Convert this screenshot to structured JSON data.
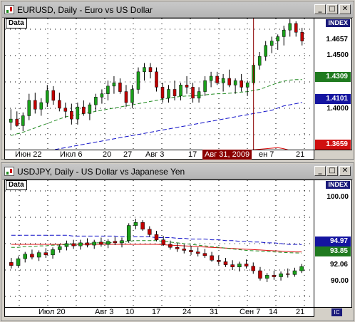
{
  "colors": {
    "bull": "#1aa01a",
    "bear": "#c00000",
    "ma_green": "#228b22",
    "ma_blue": "#1010c8",
    "ma_red": "#e01010",
    "grid": "#000000"
  },
  "windows": [
    {
      "title": "EURUSD, Daily - Euro vs US Dollar",
      "data_label": "Data",
      "index_label": "INDEX",
      "y_ticks": [
        "1.4500",
        "1.4000"
      ],
      "price_badges": [
        {
          "value": "1.4657",
          "bg": "#ffffff",
          "fg": "#000000"
        },
        {
          "value": "1.4309",
          "bg": "#1f7a1f",
          "fg": "#ffffff"
        },
        {
          "value": "1.4101",
          "bg": "#1414a0",
          "fg": "#ffffff"
        },
        {
          "value": "1.3659",
          "bg": "#d01010",
          "fg": "#ffffff"
        }
      ],
      "x_ticks": [
        "Июн 22",
        "Июл 6",
        "20",
        "27",
        "Авг 3",
        "17",
        "ен 7",
        "21"
      ],
      "x_cursor": "Авг 31, 2009",
      "chart_data": {
        "type": "candlestick",
        "ylim": [
          1.3659,
          1.4865
        ],
        "ohlc": [
          [
            1.392,
            1.404,
            1.385,
            1.395
          ],
          [
            1.395,
            1.402,
            1.388,
            1.389
          ],
          [
            1.389,
            1.401,
            1.384,
            1.398
          ],
          [
            1.398,
            1.418,
            1.394,
            1.412
          ],
          [
            1.412,
            1.419,
            1.4,
            1.404
          ],
          [
            1.404,
            1.414,
            1.398,
            1.41
          ],
          [
            1.41,
            1.426,
            1.406,
            1.421
          ],
          [
            1.421,
            1.425,
            1.408,
            1.412
          ],
          [
            1.412,
            1.419,
            1.402,
            1.405
          ],
          [
            1.405,
            1.41,
            1.396,
            1.402
          ],
          [
            1.402,
            1.409,
            1.39,
            1.395
          ],
          [
            1.395,
            1.41,
            1.39,
            1.406
          ],
          [
            1.406,
            1.412,
            1.398,
            1.4
          ],
          [
            1.4,
            1.41,
            1.394,
            1.408
          ],
          [
            1.408,
            1.418,
            1.402,
            1.415
          ],
          [
            1.415,
            1.422,
            1.409,
            1.418
          ],
          [
            1.418,
            1.43,
            1.412,
            1.425
          ],
          [
            1.425,
            1.434,
            1.418,
            1.428
          ],
          [
            1.428,
            1.432,
            1.418,
            1.42
          ],
          [
            1.42,
            1.426,
            1.406,
            1.41
          ],
          [
            1.41,
            1.426,
            1.405,
            1.422
          ],
          [
            1.422,
            1.442,
            1.418,
            1.438
          ],
          [
            1.438,
            1.446,
            1.43,
            1.442
          ],
          [
            1.442,
            1.446,
            1.432,
            1.438
          ],
          [
            1.438,
            1.442,
            1.42,
            1.424
          ],
          [
            1.424,
            1.428,
            1.41,
            1.414
          ],
          [
            1.414,
            1.426,
            1.41,
            1.422
          ],
          [
            1.422,
            1.43,
            1.412,
            1.416
          ],
          [
            1.416,
            1.428,
            1.412,
            1.426
          ],
          [
            1.426,
            1.434,
            1.418,
            1.424
          ],
          [
            1.424,
            1.428,
            1.41,
            1.414
          ],
          [
            1.414,
            1.424,
            1.41,
            1.42
          ],
          [
            1.42,
            1.434,
            1.416,
            1.43
          ],
          [
            1.43,
            1.438,
            1.424,
            1.434
          ],
          [
            1.434,
            1.438,
            1.426,
            1.428
          ],
          [
            1.428,
            1.436,
            1.42,
            1.432
          ],
          [
            1.432,
            1.44,
            1.424,
            1.426
          ],
          [
            1.426,
            1.432,
            1.418,
            1.43
          ],
          [
            1.43,
            1.436,
            1.42,
            1.424
          ],
          [
            1.424,
            1.43,
            1.416,
            1.428
          ],
          [
            1.428,
            1.446,
            1.426,
            1.444
          ],
          [
            1.444,
            1.456,
            1.44,
            1.452
          ],
          [
            1.452,
            1.466,
            1.448,
            1.462
          ],
          [
            1.462,
            1.47,
            1.455,
            1.466
          ],
          [
            1.466,
            1.472,
            1.458,
            1.47
          ],
          [
            1.47,
            1.48,
            1.462,
            1.476
          ],
          [
            1.476,
            1.486,
            1.47,
            1.482
          ],
          [
            1.482,
            1.484,
            1.47,
            1.474
          ],
          [
            1.474,
            1.478,
            1.462,
            1.466
          ]
        ],
        "moving_averages": [
          {
            "color": "green",
            "values": [
              1.38,
              1.3815,
              1.383,
              1.385,
              1.387,
              1.389,
              1.391,
              1.393,
              1.395,
              1.397,
              1.398,
              1.399,
              1.4,
              1.401,
              1.402,
              1.403,
              1.404,
              1.405,
              1.406,
              1.407,
              1.408,
              1.409,
              1.41,
              1.411,
              1.412,
              1.413,
              1.414,
              1.415,
              1.4155,
              1.416,
              1.416,
              1.4165,
              1.417,
              1.4175,
              1.418,
              1.418,
              1.4185,
              1.419,
              1.4195,
              1.42,
              1.421,
              1.422,
              1.424,
              1.426,
              1.428,
              1.4295,
              1.4305,
              1.4309,
              1.4309
            ]
          },
          {
            "color": "blue",
            "values": [
              1.36,
              1.361,
              1.362,
              1.363,
              1.364,
              1.365,
              1.366,
              1.367,
              1.368,
              1.369,
              1.37,
              1.371,
              1.372,
              1.373,
              1.374,
              1.375,
              1.376,
              1.377,
              1.378,
              1.379,
              1.38,
              1.381,
              1.382,
              1.383,
              1.384,
              1.385,
              1.386,
              1.387,
              1.388,
              1.389,
              1.39,
              1.391,
              1.392,
              1.393,
              1.394,
              1.395,
              1.396,
              1.397,
              1.398,
              1.399,
              1.4,
              1.401,
              1.402,
              1.403,
              1.405,
              1.407,
              1.408,
              1.409,
              1.4101
            ]
          },
          {
            "color": "red",
            "values": [
              1.33,
              1.331,
              1.332,
              1.333,
              1.334,
              1.335,
              1.336,
              1.337,
              1.338,
              1.339,
              1.34,
              1.341,
              1.342,
              1.343,
              1.344,
              1.345,
              1.346,
              1.347,
              1.348,
              1.349,
              1.35,
              1.351,
              1.352,
              1.353,
              1.354,
              1.355,
              1.356,
              1.357,
              1.358,
              1.359,
              1.36,
              1.361,
              1.362,
              1.363,
              1.364,
              1.3645,
              1.365,
              1.3655,
              1.366,
              1.3665,
              1.367,
              1.3675,
              1.368,
              1.3685,
              1.369,
              1.368,
              1.3665,
              1.366,
              1.3659
            ]
          }
        ],
        "cursor_index": 40
      }
    },
    {
      "title": "USDJPY, Daily - US Dollar vs Japanese Yen",
      "data_label": "Data",
      "index_label": "INDEX",
      "y_ticks": [
        "100.00",
        "90.00"
      ],
      "price_badges": [
        {
          "value": "94.97",
          "bg": "#1414a0",
          "fg": "#ffffff"
        },
        {
          "value": "93.85",
          "bg": "#1f7a1f",
          "fg": "#ffffff"
        },
        {
          "value": "92.06",
          "bg": "#ffffff",
          "fg": "#000000"
        }
      ],
      "x_ticks": [
        "Июл 20",
        "Авг 3",
        "10",
        "17",
        "24",
        "31",
        "Сен 7",
        "14",
        "21"
      ],
      "chart_data": {
        "type": "candlestick",
        "ylim": [
          86.5,
          103.5
        ],
        "ohlc": [
          [
            92.6,
            93.2,
            91.8,
            92.2
          ],
          [
            92.2,
            93.4,
            91.9,
            93.1
          ],
          [
            93.1,
            94.0,
            92.6,
            93.7
          ],
          [
            93.7,
            94.3,
            93.0,
            93.3
          ],
          [
            93.3,
            94.2,
            92.8,
            93.9
          ],
          [
            93.9,
            94.5,
            93.2,
            93.6
          ],
          [
            93.6,
            94.6,
            93.1,
            94.3
          ],
          [
            94.3,
            95.0,
            93.9,
            94.7
          ],
          [
            94.7,
            95.5,
            94.2,
            95.1
          ],
          [
            95.1,
            95.6,
            94.4,
            94.8
          ],
          [
            94.8,
            95.6,
            94.3,
            95.2
          ],
          [
            95.2,
            95.8,
            94.6,
            94.9
          ],
          [
            94.9,
            95.6,
            94.4,
            95.3
          ],
          [
            95.3,
            95.9,
            94.7,
            95.0
          ],
          [
            95.0,
            95.7,
            94.5,
            95.4
          ],
          [
            95.4,
            96.0,
            94.9,
            95.2
          ],
          [
            95.2,
            95.9,
            94.6,
            95.5
          ],
          [
            95.5,
            97.8,
            95.2,
            97.5
          ],
          [
            97.5,
            98.4,
            97.0,
            97.9
          ],
          [
            97.9,
            98.2,
            96.8,
            97.0
          ],
          [
            97.0,
            97.4,
            96.0,
            96.3
          ],
          [
            96.3,
            96.8,
            95.4,
            95.6
          ],
          [
            95.6,
            96.1,
            94.8,
            95.0
          ],
          [
            95.0,
            95.5,
            94.3,
            94.6
          ],
          [
            94.6,
            95.2,
            94.0,
            94.4
          ],
          [
            94.4,
            95.0,
            93.8,
            94.2
          ],
          [
            94.2,
            94.8,
            93.6,
            94.0
          ],
          [
            94.0,
            94.6,
            93.4,
            93.8
          ],
          [
            93.8,
            94.4,
            93.2,
            93.5
          ],
          [
            93.5,
            94.0,
            92.7,
            92.9
          ],
          [
            92.9,
            93.5,
            92.3,
            92.7
          ],
          [
            92.7,
            93.2,
            92.0,
            92.3
          ],
          [
            92.3,
            92.9,
            91.6,
            92.0
          ],
          [
            92.0,
            92.7,
            91.4,
            92.4
          ],
          [
            92.4,
            93.0,
            91.8,
            92.1
          ],
          [
            92.1,
            92.6,
            91.1,
            91.5
          ],
          [
            91.5,
            92.0,
            90.2,
            90.5
          ],
          [
            90.5,
            91.2,
            90.0,
            90.9
          ],
          [
            90.9,
            91.5,
            90.3,
            90.7
          ],
          [
            90.7,
            91.4,
            90.2,
            91.1
          ],
          [
            91.1,
            91.8,
            90.6,
            91.0
          ],
          [
            91.0,
            91.9,
            90.7,
            91.5
          ],
          [
            91.5,
            92.4,
            91.2,
            92.06
          ]
        ],
        "moving_averages": [
          {
            "color": "blue",
            "values": [
              96.2,
              96.2,
              96.2,
              96.2,
              96.2,
              96.2,
              96.2,
              96.2,
              96.2,
              96.1,
              96.1,
              96.1,
              96.1,
              96.1,
              96.1,
              96.1,
              96.0,
              96.0,
              96.0,
              96.0,
              96.0,
              95.9,
              95.9,
              95.9,
              95.8,
              95.8,
              95.7,
              95.7,
              95.7,
              95.6,
              95.6,
              95.5,
              95.5,
              95.4,
              95.4,
              95.3,
              95.3,
              95.2,
              95.2,
              95.1,
              95.0,
              95.0,
              94.97
            ]
          },
          {
            "color": "red",
            "values": [
              95.0,
              95.0,
              95.0,
              95.0,
              95.0,
              95.0,
              95.0,
              95.0,
              95.0,
              95.0,
              95.0,
              95.0,
              95.0,
              95.0,
              95.0,
              95.0,
              95.0,
              95.0,
              95.0,
              95.0,
              95.0,
              95.0,
              94.95,
              94.9,
              94.85,
              94.8,
              94.75,
              94.7,
              94.65,
              94.6,
              94.55,
              94.5,
              94.45,
              94.4,
              94.35,
              94.3,
              94.25,
              94.2,
              94.15,
              94.1,
              94.05,
              94.0,
              94.0
            ]
          },
          {
            "color": "green",
            "values": [
              94.6,
              94.6,
              94.7,
              94.7,
              94.8,
              94.8,
              94.9,
              94.9,
              95.0,
              95.0,
              95.1,
              95.1,
              95.2,
              95.2,
              95.2,
              95.3,
              95.3,
              95.4,
              95.5,
              95.5,
              95.5,
              95.5,
              95.4,
              95.3,
              95.2,
              95.1,
              95.0,
              94.9,
              94.8,
              94.7,
              94.6,
              94.5,
              94.4,
              94.3,
              94.2,
              94.15,
              94.1,
              94.05,
              94.0,
              93.95,
              93.9,
              93.87,
              93.85
            ]
          }
        ]
      }
    }
  ]
}
